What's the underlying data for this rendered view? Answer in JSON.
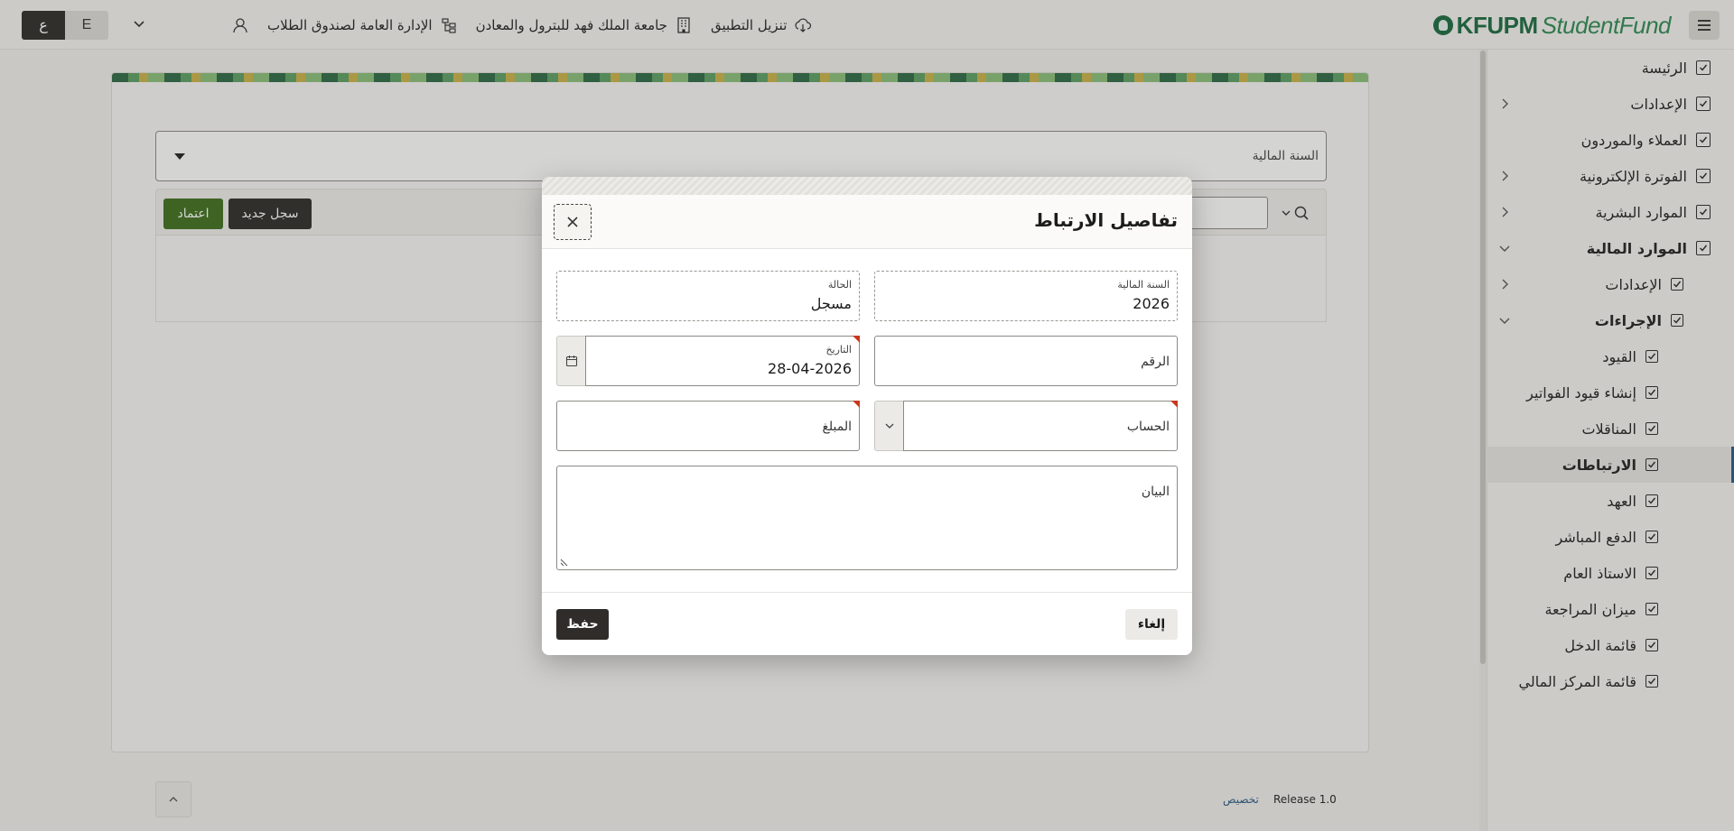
{
  "header": {
    "lang_active": "ع",
    "lang_inactive": "E",
    "links": [
      {
        "label": "الإدارة العامة لصندوق الطلاب",
        "icon": "org-chart-icon"
      },
      {
        "label": "جامعة الملك فهد للبترول والمعادن",
        "icon": "building-icon"
      },
      {
        "label": "تنزيل التطبيق",
        "icon": "cloud-download-icon"
      }
    ],
    "brand_bold": "KFUPM",
    "brand_light": "StudentFund"
  },
  "sidebar": {
    "items": [
      {
        "label": "الرئيسة",
        "level": 1,
        "arrow": false
      },
      {
        "label": "الإعدادات",
        "level": 1,
        "arrow": true
      },
      {
        "label": "العملاء والموردون",
        "level": 1,
        "arrow": false
      },
      {
        "label": "الفوترة الإلكترونية",
        "level": 1,
        "arrow": true
      },
      {
        "label": "الموارد البشرية",
        "level": 1,
        "arrow": true
      },
      {
        "label": "الموارد المالية",
        "level": 1,
        "arrow": "down",
        "bold": true
      },
      {
        "label": "الإعدادات",
        "level": 2,
        "arrow": true
      },
      {
        "label": "الإجراءات",
        "level": 2,
        "arrow": "down",
        "bold": true
      },
      {
        "label": "القيود",
        "level": 3
      },
      {
        "label": "إنشاء قيود الفواتير",
        "level": 3
      },
      {
        "label": "المناقلات",
        "level": 3
      },
      {
        "label": "الارتباطات",
        "level": 3,
        "active": true
      },
      {
        "label": "العهد",
        "level": 3
      },
      {
        "label": "الدفع المباشر",
        "level": 3
      },
      {
        "label": "الاستاذ العام",
        "level": 3
      },
      {
        "label": "ميزان المراجعة",
        "level": 3
      },
      {
        "label": "قائمة الدخل",
        "level": 3
      },
      {
        "label": "قائمة المركز المالي",
        "level": 3
      }
    ]
  },
  "main": {
    "fiscal_year_label": "السنة المالية",
    "approve_label": "اعتماد",
    "new_record_label": "سجل جديد"
  },
  "footer": {
    "release": "Release 1.0",
    "customize": "تخصيص"
  },
  "dialog": {
    "title": "تفاصيل الارتباط",
    "fields": {
      "fiscal_year": {
        "label": "السنة المالية",
        "value": "2026"
      },
      "status": {
        "label": "الحالة",
        "value": "مسجل"
      },
      "number": {
        "label": "الرقم"
      },
      "date": {
        "label": "التاريخ",
        "value": "28-04-2026"
      },
      "account": {
        "label": "الحساب"
      },
      "amount": {
        "label": "المبلغ"
      },
      "statement": {
        "label": "البيان"
      }
    },
    "save_label": "حفظ",
    "cancel_label": "إلغاء"
  },
  "colors": {
    "brand_green": "#1b6b3f",
    "approve_green": "#3f6f1e",
    "dark_button": "#2f2c2a",
    "active_accent": "#2c5b86",
    "required_marker": "#c7371f"
  }
}
